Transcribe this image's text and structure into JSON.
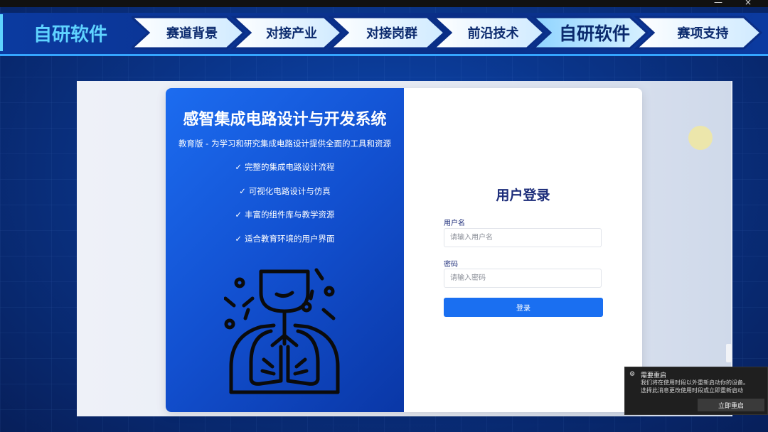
{
  "brand": {
    "title": "自研软件"
  },
  "nav": {
    "items": [
      {
        "label": "赛道背景"
      },
      {
        "label": "对接产业"
      },
      {
        "label": "对接岗群"
      },
      {
        "label": "前沿技术"
      },
      {
        "label": "自研软件"
      },
      {
        "label": "赛项支持"
      }
    ],
    "active_index": 4
  },
  "left_panel": {
    "title": "感智集成电路设计与开发系统",
    "subtitle": "教育版 - 为学习和研究集成电路设计提供全面的工具和资源",
    "features": [
      "完整的集成电路设计流程",
      "可视化电路设计与仿真",
      "丰富的组件库与教学资源",
      "适合教育环境的用户界面"
    ],
    "check_glyph": "✓",
    "illustration_icon": "person-lungs-icon"
  },
  "login": {
    "title": "用户登录",
    "username_label": "用户名",
    "username_placeholder": "请输入用户名",
    "password_label": "密码",
    "password_placeholder": "请输入密码",
    "submit_label": "登录"
  },
  "notification": {
    "title": "需要重启",
    "message_line1": "我们将在使用时段以外重新启动你的设备。",
    "message_line2": "选择此消息更改使用时段或立即重新启动",
    "action_label": "立即重启",
    "icon": "gear-icon"
  },
  "colors": {
    "background": "#0a2f7a",
    "accent": "#35a6ff",
    "brand_text": "#5fd3ff",
    "nav_chevron": "#e6f4ff",
    "login_button": "#1a6ff1",
    "panel_blue": "#1250d0"
  }
}
